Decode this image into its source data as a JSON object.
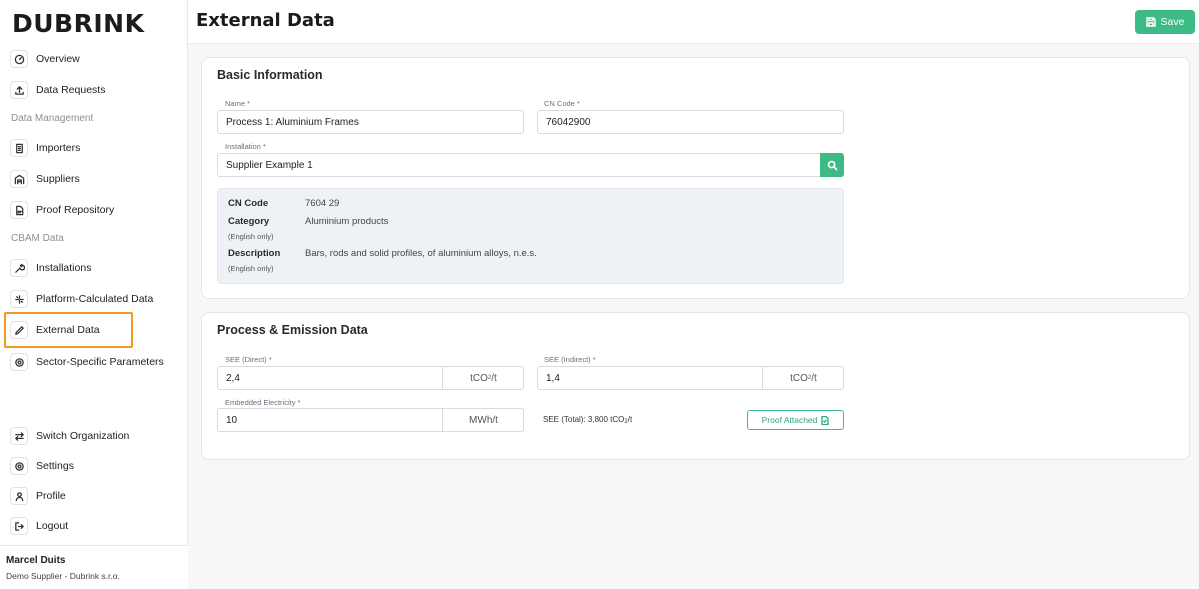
{
  "brand": {
    "logo_text": "DUBRINK"
  },
  "sidebar": {
    "items": [
      {
        "label": "Overview",
        "icon": "gauge-icon"
      },
      {
        "label": "Data Requests",
        "icon": "upload-icon"
      }
    ],
    "section_data_management": "Data Management",
    "data_management_items": [
      {
        "label": "Importers",
        "icon": "building-icon"
      },
      {
        "label": "Suppliers",
        "icon": "warehouse-icon"
      },
      {
        "label": "Proof Repository",
        "icon": "file-icon"
      }
    ],
    "section_cbam": "CBAM Data",
    "cbam_items": [
      {
        "label": "Installations",
        "icon": "wrench-icon"
      },
      {
        "label": "Platform-Calculated Data",
        "icon": "sparkle-icon"
      },
      {
        "label": "External Data",
        "icon": "pencil-icon",
        "active": true
      },
      {
        "label": "Sector-Specific Parameters",
        "icon": "cog-icon"
      }
    ],
    "bottom_items": [
      {
        "label": "Switch Organization",
        "icon": "swap-icon"
      },
      {
        "label": "Settings",
        "icon": "settings-icon"
      },
      {
        "label": "Profile",
        "icon": "user-icon"
      },
      {
        "label": "Logout",
        "icon": "logout-icon"
      }
    ],
    "user": {
      "name": "Marcel Duits",
      "org": "Demo Supplier - Dubrink s.r.o."
    }
  },
  "header": {
    "title": "External Data",
    "save_label": "Save"
  },
  "basic": {
    "title": "Basic Information",
    "name_label": "Name *",
    "name_value": "Process 1: Aluminium Frames",
    "cn_label": "CN Code *",
    "cn_value": "76042900",
    "installation_label": "Installation *",
    "installation_value": "Supplier Example 1",
    "info": {
      "cn_key": "CN Code",
      "cn_val": "7604 29",
      "category_key": "Category",
      "category_sub": "(English only)",
      "category_val": "Aluminium products",
      "description_key": "Description",
      "description_sub": "(English only)",
      "description_val": "Bars, rods and solid profiles, of aluminium alloys, n.e.s."
    }
  },
  "process": {
    "title": "Process & Emission Data",
    "see_direct_label": "SEE (Direct) *",
    "see_direct_value": "2,4",
    "see_direct_unit_base": "tCO",
    "see_direct_unit_sub": "2",
    "see_direct_unit_tail": "/t",
    "see_indirect_label": "SEE (Indirect) *",
    "see_indirect_value": "1,4",
    "see_indirect_unit_base": "tCO",
    "see_indirect_unit_sub": "2",
    "see_indirect_unit_tail": "/t",
    "electricity_label": "Embedded Electricity *",
    "electricity_value": "10",
    "electricity_unit": "MWh/t",
    "total_prefix": "SEE (Total): 3,800 tCO",
    "total_sub": "2",
    "total_tail": "/t",
    "proof_label": "Proof Attached"
  },
  "colors": {
    "accent": "#3dbb87",
    "highlight": "#f29a1f"
  }
}
